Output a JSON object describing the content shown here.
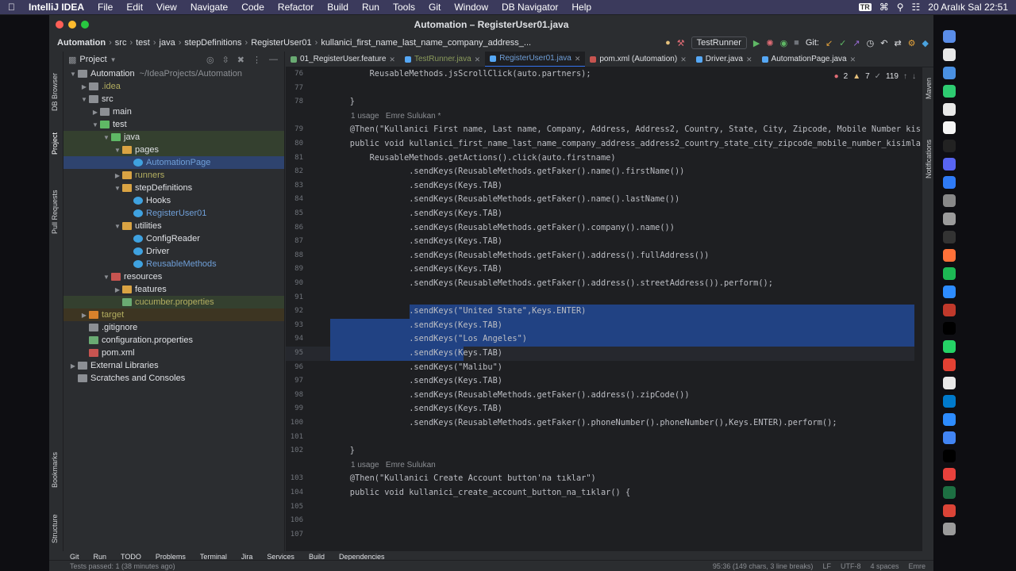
{
  "menubar": {
    "app": "IntelliJ IDEA",
    "items": [
      "File",
      "Edit",
      "View",
      "Navigate",
      "Code",
      "Refactor",
      "Build",
      "Run",
      "Tools",
      "Git",
      "Window",
      "DB Navigator",
      "Help"
    ],
    "input_badge": "TR",
    "datetime": "20 Aralık Sal  22:51"
  },
  "window": {
    "title": "Automation – RegisterUser01.java",
    "breadcrumbs": [
      "Automation",
      "src",
      "test",
      "java",
      "stepDefinitions",
      "RegisterUser01",
      "kullanici_first_name_last_name_company_address_..."
    ],
    "run_config": "TestRunner",
    "git_label": "Git:"
  },
  "left_strip": {
    "db_browser": "DB Browser",
    "project": "Project",
    "pull_requests": "Pull Requests",
    "bookmarks": "Bookmarks",
    "structure": "Structure"
  },
  "project": {
    "header": "Project",
    "tree": [
      {
        "label": "Automation",
        "extra": "~/IdeaProjects/Automation",
        "depth": 0,
        "arrow": "v",
        "icon": "folder",
        "hl": ""
      },
      {
        "label": ".idea",
        "depth": 1,
        "arrow": ">",
        "icon": "folder",
        "hl": "",
        "color": "yellow"
      },
      {
        "label": "src",
        "depth": 1,
        "arrow": "v",
        "icon": "folder",
        "hl": ""
      },
      {
        "label": "main",
        "depth": 2,
        "arrow": ">",
        "icon": "folder",
        "hl": ""
      },
      {
        "label": "test",
        "depth": 2,
        "arrow": "v",
        "icon": "folder-green",
        "hl": ""
      },
      {
        "label": "java",
        "depth": 3,
        "arrow": "v",
        "icon": "folder-green",
        "hl": "green"
      },
      {
        "label": "pages",
        "depth": 4,
        "arrow": "v",
        "icon": "folder-yellow",
        "hl": "green"
      },
      {
        "label": "AutomationPage",
        "depth": 5,
        "arrow": "",
        "icon": "class",
        "hl": "sel",
        "color": "blue"
      },
      {
        "label": "runners",
        "depth": 4,
        "arrow": ">",
        "icon": "folder-yellow",
        "hl": "",
        "color": "yellow"
      },
      {
        "label": "stepDefinitions",
        "depth": 4,
        "arrow": "v",
        "icon": "folder-yellow",
        "hl": ""
      },
      {
        "label": "Hooks",
        "depth": 5,
        "arrow": "",
        "icon": "class",
        "hl": ""
      },
      {
        "label": "RegisterUser01",
        "depth": 5,
        "arrow": "",
        "icon": "class",
        "hl": "",
        "color": "blue"
      },
      {
        "label": "utilities",
        "depth": 4,
        "arrow": "v",
        "icon": "folder-yellow",
        "hl": ""
      },
      {
        "label": "ConfigReader",
        "depth": 5,
        "arrow": "",
        "icon": "class",
        "hl": ""
      },
      {
        "label": "Driver",
        "depth": 5,
        "arrow": "",
        "icon": "class",
        "hl": ""
      },
      {
        "label": "ReusableMethods",
        "depth": 5,
        "arrow": "",
        "icon": "class",
        "hl": "",
        "color": "blue"
      },
      {
        "label": "resources",
        "depth": 3,
        "arrow": "v",
        "icon": "folder-res",
        "hl": ""
      },
      {
        "label": "features",
        "depth": 4,
        "arrow": ">",
        "icon": "folder-yellow",
        "hl": ""
      },
      {
        "label": "cucumber.properties",
        "depth": 4,
        "arrow": "",
        "icon": "props",
        "hl": "green",
        "color": "yellow"
      },
      {
        "label": "target",
        "depth": 1,
        "arrow": ">",
        "icon": "folder-orange",
        "hl": "brown",
        "color": "yellow"
      },
      {
        "label": ".gitignore",
        "depth": 1,
        "arrow": "",
        "icon": "file",
        "hl": ""
      },
      {
        "label": "configuration.properties",
        "depth": 1,
        "arrow": "",
        "icon": "props",
        "hl": ""
      },
      {
        "label": "pom.xml",
        "depth": 1,
        "arrow": "",
        "icon": "maven",
        "hl": ""
      },
      {
        "label": "External Libraries",
        "depth": 0,
        "arrow": ">",
        "icon": "lib",
        "hl": ""
      },
      {
        "label": "Scratches and Consoles",
        "depth": 0,
        "arrow": "",
        "icon": "scratch",
        "hl": ""
      }
    ]
  },
  "tabs": [
    {
      "label": "01_RegisterUser.feature",
      "color": "#6aab73",
      "active": false
    },
    {
      "label": "TestRunner.java",
      "color": "#56a8f5",
      "active": false,
      "dim": true
    },
    {
      "label": "RegisterUser01.java",
      "color": "#56a8f5",
      "active": true
    },
    {
      "label": "pom.xml (Automation)",
      "color": "#c75450",
      "active": false
    },
    {
      "label": "Driver.java",
      "color": "#56a8f5",
      "active": false
    },
    {
      "label": "AutomationPage.java",
      "color": "#56a8f5",
      "active": false
    }
  ],
  "inspections": {
    "errors": "2",
    "warnings": "7",
    "weak": "119"
  },
  "code": [
    {
      "n": "76",
      "t": "        ReusableMethods.jsScrollClick(auto.partners);"
    },
    {
      "n": "77",
      "t": ""
    },
    {
      "n": "78",
      "t": "    }"
    },
    {
      "n": "",
      "t": "1 usage   Emre Sulukan *",
      "usage": true
    },
    {
      "n": "79",
      "t": "    @Then(\"Kullanici First name, Last name, Company, Address, Address2, Country, State, City, Zipcode, Mobile Number kis"
    },
    {
      "n": "80",
      "t": "    public void kullanici_first_name_last_name_company_address_address2_country_state_city_zipcode_mobile_number_kisimla"
    },
    {
      "n": "81",
      "t": "        ReusableMethods.getActions().click(auto.firstname)"
    },
    {
      "n": "82",
      "t": "                .sendKeys(ReusableMethods.getFaker().name().firstName())"
    },
    {
      "n": "83",
      "t": "                .sendKeys(Keys.TAB)"
    },
    {
      "n": "84",
      "t": "                .sendKeys(ReusableMethods.getFaker().name().lastName())"
    },
    {
      "n": "85",
      "t": "                .sendKeys(Keys.TAB)"
    },
    {
      "n": "86",
      "t": "                .sendKeys(ReusableMethods.getFaker().company().name())"
    },
    {
      "n": "87",
      "t": "                .sendKeys(Keys.TAB)"
    },
    {
      "n": "88",
      "t": "                .sendKeys(ReusableMethods.getFaker().address().fullAddress())"
    },
    {
      "n": "89",
      "t": "                .sendKeys(Keys.TAB)"
    },
    {
      "n": "90",
      "t": "                .sendKeys(ReusableMethods.getFaker().address().streetAddress()).perform();"
    },
    {
      "n": "91",
      "t": ""
    },
    {
      "n": "92",
      "t": "                .sendKeys(\"United State\",Keys.ENTER)",
      "sel": "partial"
    },
    {
      "n": "93",
      "t": "                .sendKeys(Keys.TAB)",
      "sel": "full"
    },
    {
      "n": "94",
      "t": "                .sendKeys(\"Los Angeles\")",
      "sel": "full"
    },
    {
      "n": "95",
      "t": "                .sendKeys(Keys.TAB)",
      "sel": "full",
      "current": true
    },
    {
      "n": "96",
      "t": "                .sendKeys(\"Malibu\")"
    },
    {
      "n": "97",
      "t": "                .sendKeys(Keys.TAB)"
    },
    {
      "n": "98",
      "t": "                .sendKeys(ReusableMethods.getFaker().address().zipCode())"
    },
    {
      "n": "99",
      "t": "                .sendKeys(Keys.TAB)"
    },
    {
      "n": "100",
      "t": "                .sendKeys(ReusableMethods.getFaker().phoneNumber().phoneNumber(),Keys.ENTER).perform();"
    },
    {
      "n": "101",
      "t": ""
    },
    {
      "n": "102",
      "t": "    }"
    },
    {
      "n": "",
      "t": "1 usage   Emre Sulukan",
      "usage": true
    },
    {
      "n": "103",
      "t": "    @Then(\"Kullanici Create Account button'na tıklar\")"
    },
    {
      "n": "104",
      "t": "    public void kullanici_create_account_button_na_tıklar() {"
    },
    {
      "n": "105",
      "t": ""
    },
    {
      "n": "106",
      "t": ""
    },
    {
      "n": "107",
      "t": ""
    }
  ],
  "toolwindows": [
    "Git",
    "Run",
    "TODO",
    "Problems",
    "Terminal",
    "Jira",
    "Services",
    "Build",
    "Dependencies"
  ],
  "status": {
    "left": "Tests passed: 1 (38 minutes ago)",
    "position": "95:36 (149 chars, 3 line breaks)",
    "line_sep": "LF",
    "encoding": "UTF-8",
    "indent": "4 spaces",
    "user": "Emre"
  },
  "right_strip": {
    "maven": "Maven",
    "notifications": "Notifications"
  },
  "dock_colors": [
    "#5a8de8",
    "#e8e8e8",
    "#4a90e2",
    "#2ecc71",
    "#e8e8e8",
    "#f5f5f5",
    "#222222",
    "#5865f2",
    "#2f7bf6",
    "#888888",
    "#9b9b9b",
    "#333333",
    "#ff7139",
    "#1db954",
    "#2d8cff",
    "#c0392b",
    "#000000",
    "#25d366",
    "#e34133",
    "#e8e8e8",
    "#007acc",
    "#2d8cff",
    "#4285f4",
    "#000000",
    "#e8413c",
    "#1d6f42",
    "#db4437",
    "#9b9b9b"
  ]
}
